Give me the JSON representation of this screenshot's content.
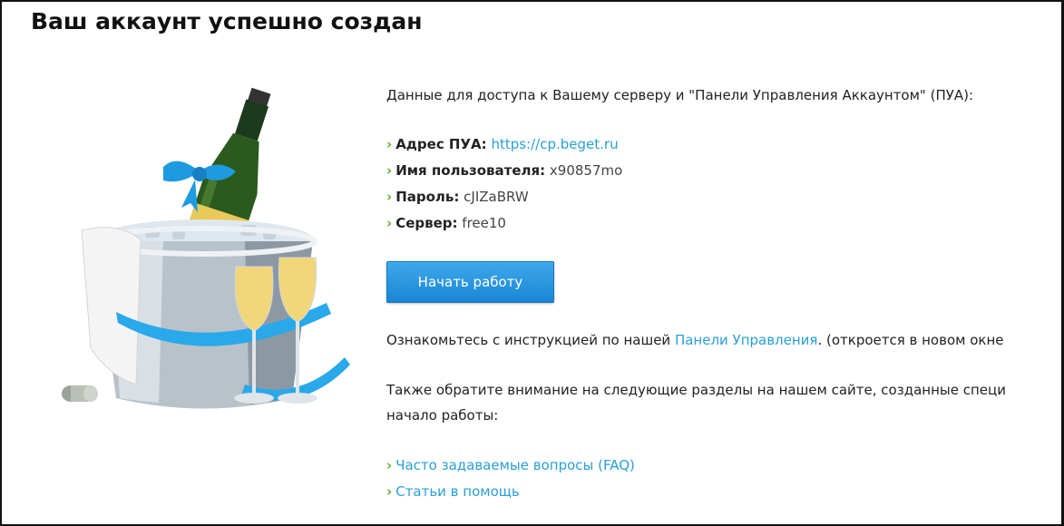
{
  "page": {
    "title": "Ваш аккаунт успешно создан"
  },
  "intro_text": "Данные для доступа к Вашему серверу и \"Панели Управления Аккаунтом\" (ПУА):",
  "credentials": [
    {
      "label": "Адрес ПУА:",
      "value": "https://cp.beget.ru",
      "is_link": true
    },
    {
      "label": "Имя пользователя:",
      "value": "x90857mo"
    },
    {
      "label": "Пароль:",
      "value": "cJIZaBRW"
    },
    {
      "label": "Сервер:",
      "value": "free10"
    }
  ],
  "start_button": {
    "label": "Начать работу"
  },
  "instruction": {
    "before": "Ознакомьтесь с инструкцией по нашей ",
    "link": "Панели Управления",
    "after": ". (откроется в новом окне"
  },
  "sections_text": {
    "line1": "Также обратите внимание на следующие разделы на нашем сайте, созданные специ",
    "line2": "начало работы:"
  },
  "links": [
    {
      "label": "Часто задаваемые вопросы (FAQ)"
    },
    {
      "label": "Статьи в помощь"
    }
  ],
  "colors": {
    "accent": "#2a9fd6",
    "arrow": "#5cb225",
    "button": "#1a86d4"
  }
}
